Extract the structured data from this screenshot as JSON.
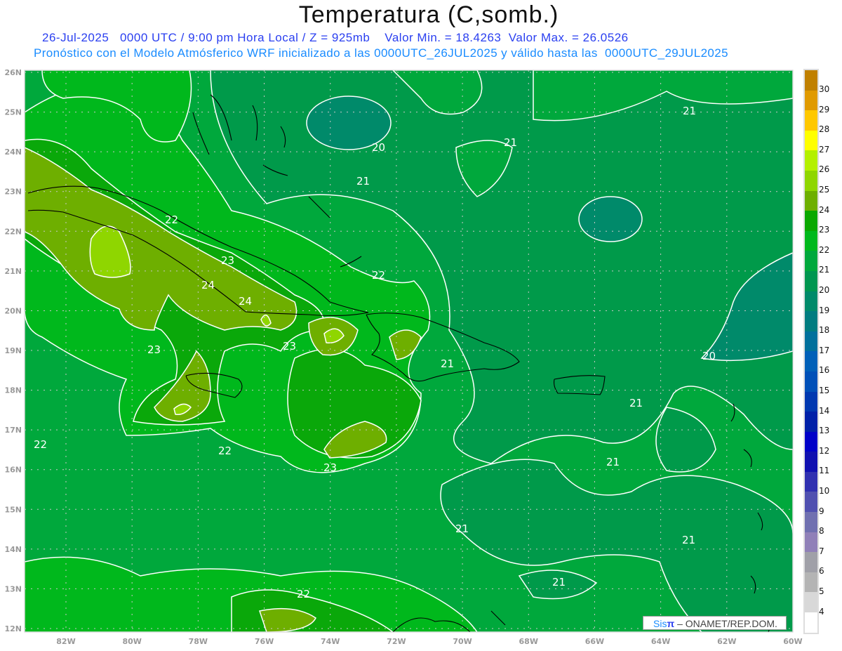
{
  "header": {
    "title": "Temperatura (C,somb.)",
    "subtitle": "26-Jul-2025   0000 UTC / 9:00 pm Hora Local / Z = 925mb    Valor Min. = 18.4263  Valor Max. = 26.0526",
    "model_line": "Pronóstico con el Modelo Atmósferico WRF inicializado a las 0000UTC_26JUL2025 y válido hasta las  0000UTC_29JUL2025"
  },
  "axes": {
    "lon_labels": [
      "82W",
      "80W",
      "78W",
      "76W",
      "74W",
      "72W",
      "70W",
      "68W",
      "66W",
      "64W",
      "62W",
      "60W"
    ],
    "lon_values": [
      -82,
      -80,
      -78,
      -76,
      -74,
      -72,
      -70,
      -68,
      -66,
      -64,
      -62,
      -60
    ],
    "lat_labels": [
      "12N",
      "13N",
      "14N",
      "15N",
      "16N",
      "17N",
      "18N",
      "19N",
      "20N",
      "21N",
      "22N",
      "23N",
      "24N",
      "25N",
      "26N"
    ],
    "lat_values": [
      12,
      13,
      14,
      15,
      16,
      17,
      18,
      19,
      20,
      21,
      22,
      23,
      24,
      25,
      26
    ]
  },
  "contour_labels": [
    "22",
    "23",
    "24",
    "24",
    "23",
    "23",
    "22",
    "21",
    "20",
    "21",
    "21",
    "21",
    "20",
    "21",
    "21",
    "21",
    "21",
    "21",
    "22",
    "22",
    "22",
    "23"
  ],
  "colorbar": {
    "labels": [
      "30",
      "29",
      "28",
      "27",
      "26",
      "25",
      "24",
      "23",
      "22",
      "21",
      "20",
      "19",
      "18",
      "17",
      "16",
      "15",
      "14",
      "13",
      "12",
      "11",
      "10",
      "9",
      "8",
      "7",
      "6",
      "5",
      "4"
    ],
    "colors": [
      "#c08000",
      "#e09a00",
      "#ffc800",
      "#ffff00",
      "#b4f000",
      "#8fd600",
      "#6eaf00",
      "#0aa800",
      "#00b81c",
      "#00a83c",
      "#009650",
      "#008a6a",
      "#007c80",
      "#00709c",
      "#0060b8",
      "#0050b8",
      "#0038b0",
      "#0020a8",
      "#0000c8",
      "#1010b0",
      "#3030b0",
      "#5050b0",
      "#7070b0",
      "#9080b8",
      "#a0a0a8",
      "#b4b4b4",
      "#d8d8d8",
      "#ffffff"
    ]
  },
  "footer": {
    "logo_sis": "Sis",
    "logo_pi": "π",
    "logo_text": "– ONAMET/REP.DOM."
  }
}
